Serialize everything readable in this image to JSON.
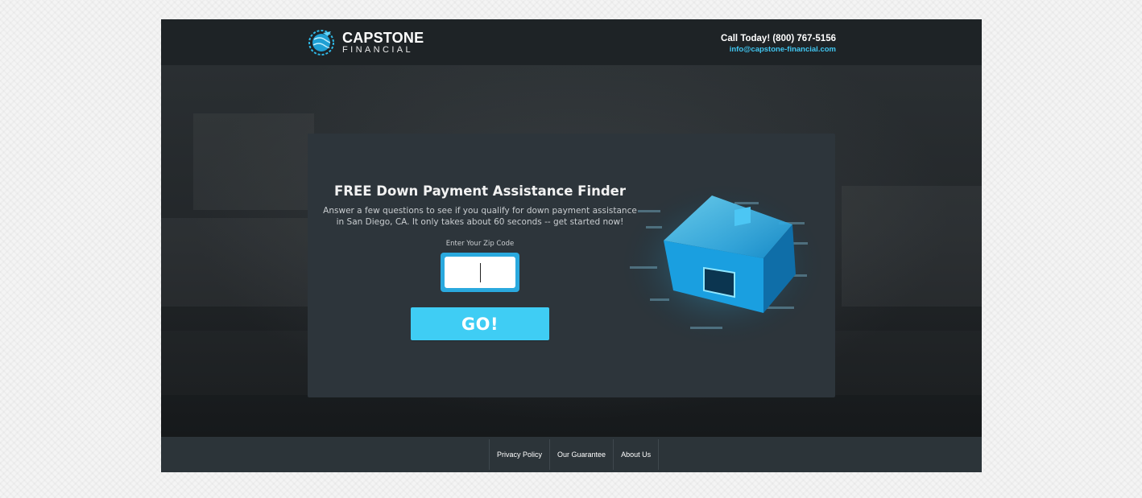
{
  "header": {
    "logo": {
      "name": "CAPSTONE",
      "subtitle": "FINANCIAL"
    },
    "contact": {
      "phone": "Call Today! (800) 767-5156",
      "email": "info@capstone-financial.com"
    }
  },
  "card": {
    "title": "FREE Down Payment Assistance Finder",
    "description_line1": "Answer a few questions to see if you qualify for down payment assistance",
    "description_line2": "in San Diego, CA. It only takes about 60 seconds -- get started now!",
    "zip_label": "Enter Your Zip Code",
    "zip_value": "",
    "go_label": "GO!"
  },
  "footer": {
    "links": [
      {
        "label": "Privacy Policy"
      },
      {
        "label": "Our Guarantee"
      },
      {
        "label": "About Us"
      }
    ]
  },
  "colors": {
    "accent": "#3fcdf4",
    "accent_dark": "#2aa9de",
    "card_bg": "#2d353b",
    "header_bg": "#1e2326",
    "footer_bg": "#2c3439"
  }
}
